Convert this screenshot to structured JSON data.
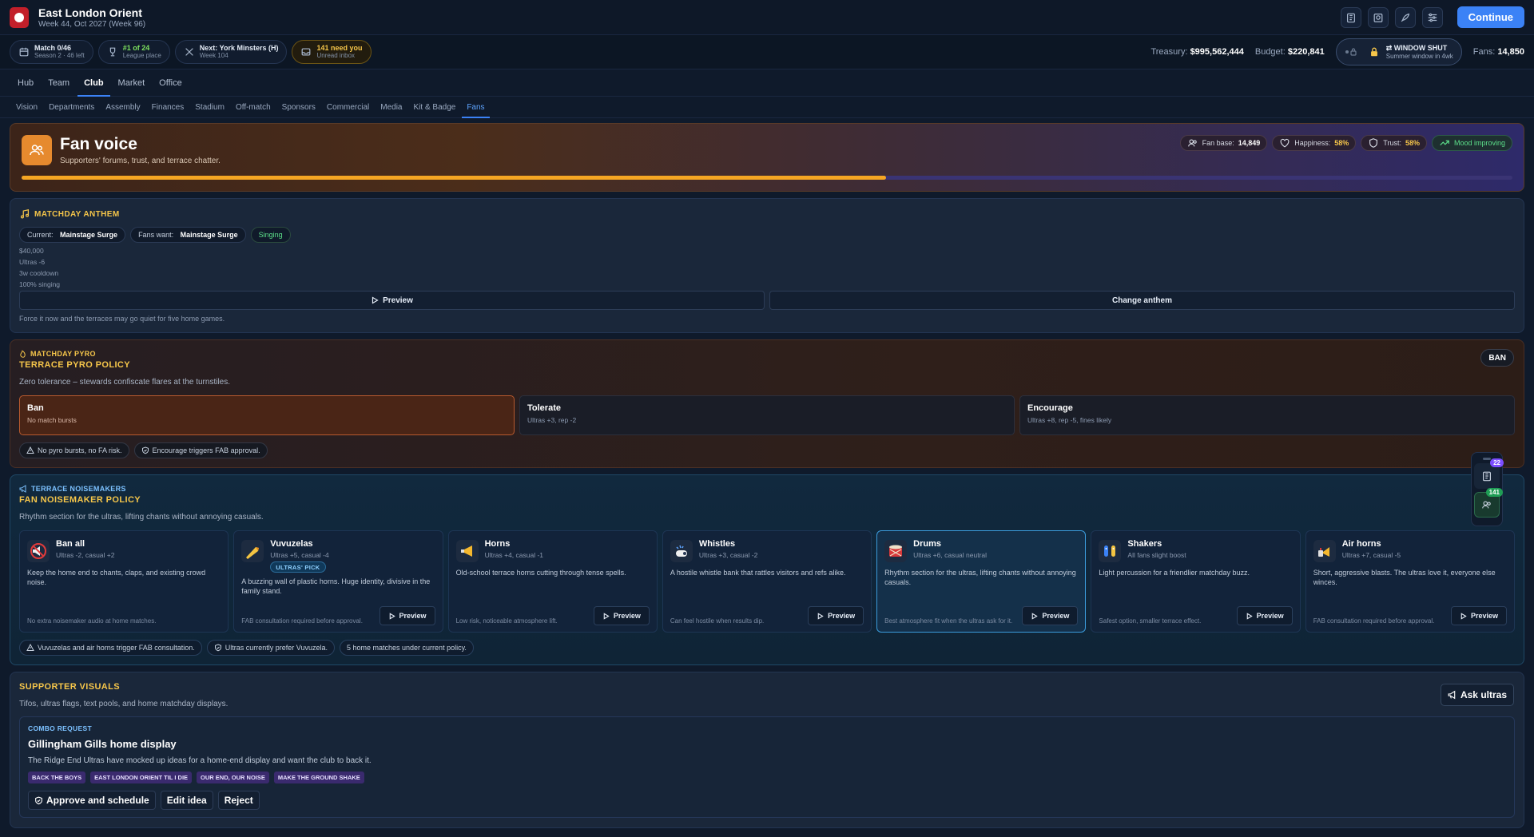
{
  "header": {
    "club": "East London Orient",
    "subtitle": "Week 44, Oct 2027 (Week 96)",
    "continue_label": "Continue"
  },
  "status": {
    "match": {
      "title": "Match 0/46",
      "sub": "Season 2 · 46 left"
    },
    "league": {
      "title": "#1 of 24",
      "sub": "League place"
    },
    "next": {
      "title": "Next: York Minsters (H)",
      "sub": "Week 104"
    },
    "inbox": {
      "title": "141 need you",
      "sub": "Unread inbox"
    },
    "treasury_label": "Treasury:",
    "treasury": "$995,562,444",
    "budget_label": "Budget:",
    "budget": "$220,841",
    "window_title": "WINDOW SHUT",
    "window_sub": "Summer window in 4wk",
    "fans_label": "Fans:",
    "fans": "14,850"
  },
  "nav": {
    "main": [
      "Hub",
      "Team",
      "Club",
      "Market",
      "Office"
    ],
    "sub": [
      "Vision",
      "Departments",
      "Assembly",
      "Finances",
      "Stadium",
      "Off-match",
      "Sponsors",
      "Commercial",
      "Media",
      "Kit & Badge",
      "Fans"
    ]
  },
  "hero": {
    "title": "Fan voice",
    "subtitle": "Supporters' forums, trust, and terrace chatter.",
    "fan_base_label": "Fan base:",
    "fan_base": "14,849",
    "happiness_label": "Happiness:",
    "happiness": "58%",
    "trust_label": "Trust:",
    "trust": "58%",
    "mood": "Mood improving",
    "progress": 0.58
  },
  "anthem": {
    "heading": "MATCHDAY ANTHEM",
    "current_label": "Current:",
    "current": "Mainstage Surge",
    "want_label": "Fans want:",
    "want": "Mainstage Surge",
    "status": "Singing",
    "details": [
      "$40,000",
      "Ultras -6",
      "3w cooldown",
      "100% singing"
    ],
    "preview_label": "Preview",
    "change_label": "Change anthem",
    "note": "Force it now and the terraces may go quiet for five home games."
  },
  "pyro": {
    "kicker": "MATCHDAY PYRO",
    "title": "TERRACE PYRO POLICY",
    "badge": "BAN",
    "desc": "Zero tolerance – stewards confiscate flares at the turnstiles.",
    "options": [
      {
        "title": "Ban",
        "sub": "No match bursts"
      },
      {
        "title": "Tolerate",
        "sub": "Ultras +3, rep -2"
      },
      {
        "title": "Encourage",
        "sub": "Ultras +8, rep -5, fines likely"
      }
    ],
    "notes": [
      "No pyro bursts, no FA risk.",
      "Encourage triggers FAB approval."
    ]
  },
  "noise": {
    "kicker": "TERRACE NOISEMAKERS",
    "title": "FAN NOISEMAKER POLICY",
    "desc": "Rhythm section for the ultras, lifting chants without annoying casuals.",
    "preview_label": "Preview",
    "tag": "ULTRAS' PICK",
    "items": [
      {
        "name": "Ban all",
        "sub": "Ultras -2, casual +2",
        "desc": "Keep the home end to chants, claps, and existing crowd noise.",
        "note": "No extra noisemaker audio at home matches."
      },
      {
        "name": "Vuvuzelas",
        "sub": "Ultras +5, casual -4",
        "desc": "A buzzing wall of plastic horns. Huge identity, divisive in the family stand.",
        "note": "FAB consultation required before approval."
      },
      {
        "name": "Horns",
        "sub": "Ultras +4, casual -1",
        "desc": "Old-school terrace horns cutting through tense spells.",
        "note": "Low risk, noticeable atmosphere lift."
      },
      {
        "name": "Whistles",
        "sub": "Ultras +3, casual -2",
        "desc": "A hostile whistle bank that rattles visitors and refs alike.",
        "note": "Can feel hostile when results dip."
      },
      {
        "name": "Drums",
        "sub": "Ultras +6, casual neutral",
        "desc": "Rhythm section for the ultras, lifting chants without annoying casuals.",
        "note": "Best atmosphere fit when the ultras ask for it."
      },
      {
        "name": "Shakers",
        "sub": "All fans slight boost",
        "desc": "Light percussion for a friendlier matchday buzz.",
        "note": "Safest option, smaller terrace effect."
      },
      {
        "name": "Air horns",
        "sub": "Ultras +7, casual -5",
        "desc": "Short, aggressive blasts. The ultras love it, everyone else winces.",
        "note": "FAB consultation required before approval."
      }
    ],
    "notes": [
      "Vuvuzelas and air horns trigger FAB consultation.",
      "Ultras currently prefer Vuvuzela.",
      "5 home matches under current policy."
    ]
  },
  "visuals": {
    "title": "SUPPORTER VISUALS",
    "desc": "Tifos, ultras flags, text pools, and home matchday displays.",
    "ask_label": "Ask ultras",
    "combo_kicker": "COMBO REQUEST",
    "combo_title": "Gillingham Gills home display",
    "combo_desc": "The Ridge End Ultras have mocked up ideas for a home-end display and want the club to back it.",
    "tags": [
      "BACK THE BOYS",
      "EAST LONDON ORIENT TIL I DIE",
      "OUR END, OUR NOISE",
      "MAKE THE GROUND SHAKE"
    ],
    "approve_label": "Approve and schedule",
    "edit_label": "Edit idea",
    "reject_label": "Reject"
  },
  "floating": {
    "tasks_badge": "22",
    "fans_badge": "141"
  }
}
